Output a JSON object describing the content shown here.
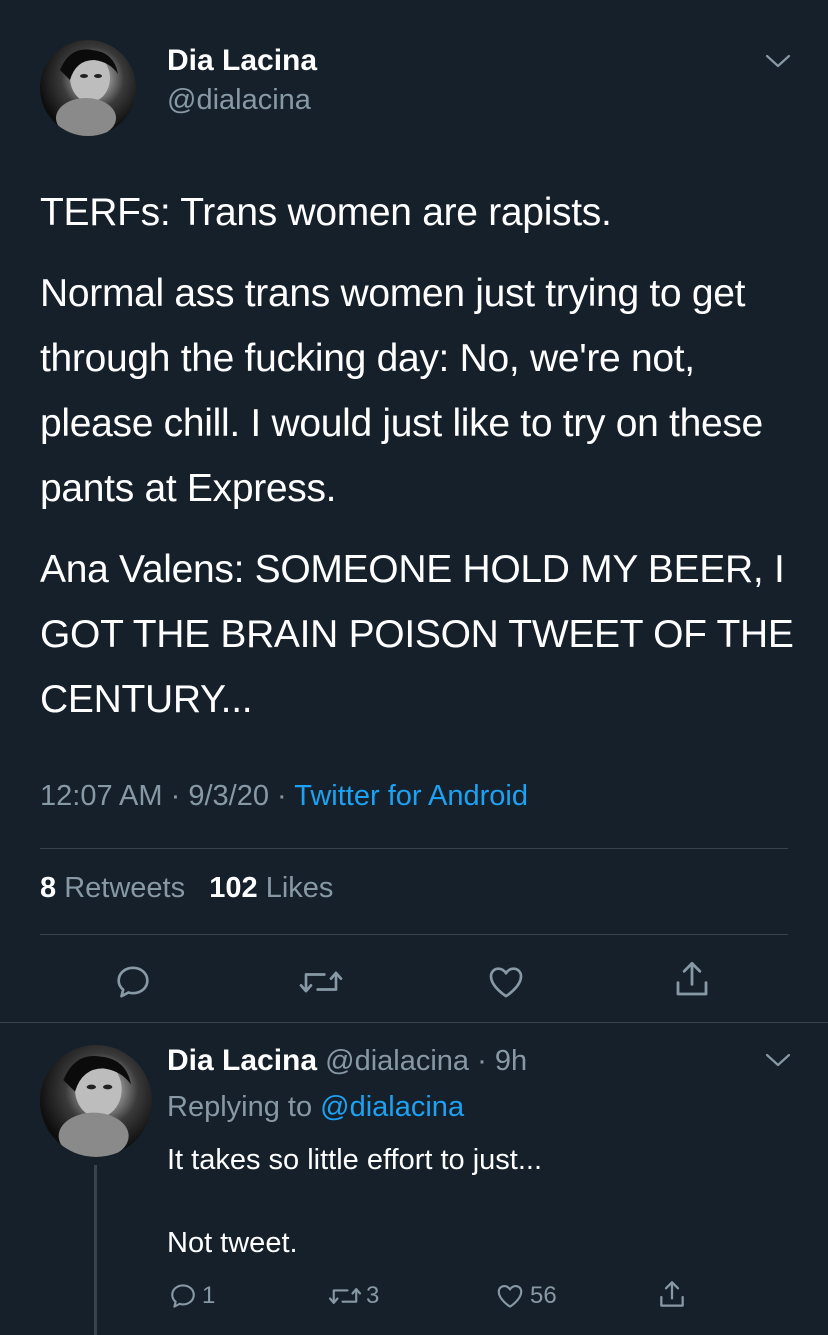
{
  "main_tweet": {
    "author_name": "Dia Lacina",
    "author_handle": "@dialacina",
    "paragraphs": [
      "TERFs: Trans women are rapists.",
      "Normal ass trans women just trying to get through the fucking day: No, we're not, please chill. I would just like to try on these pants at Express.",
      "Ana Valens: SOMEONE HOLD MY BEER, I GOT THE BRAIN POISON TWEET OF THE CENTURY..."
    ],
    "time": "12:07 AM",
    "date": "9/3/20",
    "separator": "·",
    "source": "Twitter for Android",
    "retweets_count": "8",
    "retweets_label": "Retweets",
    "likes_count": "102",
    "likes_label": "Likes"
  },
  "reply_tweet": {
    "author_name": "Dia Lacina",
    "author_handle": "@dialacina",
    "age": "9h",
    "replying_to_label": "Replying to",
    "replying_to_handle": "@dialacina",
    "line1": "It takes so little effort to just...",
    "line2": "Not tweet.",
    "reply_count": "1",
    "retweet_count": "3",
    "like_count": "56"
  },
  "colors": {
    "background": "#15202b",
    "text": "#ffffff",
    "secondary": "#8899a6",
    "accent": "#1da1f2",
    "divider": "#38444d"
  },
  "icons": [
    "chevron-down-icon",
    "reply-icon",
    "retweet-icon",
    "like-icon",
    "share-icon"
  ]
}
